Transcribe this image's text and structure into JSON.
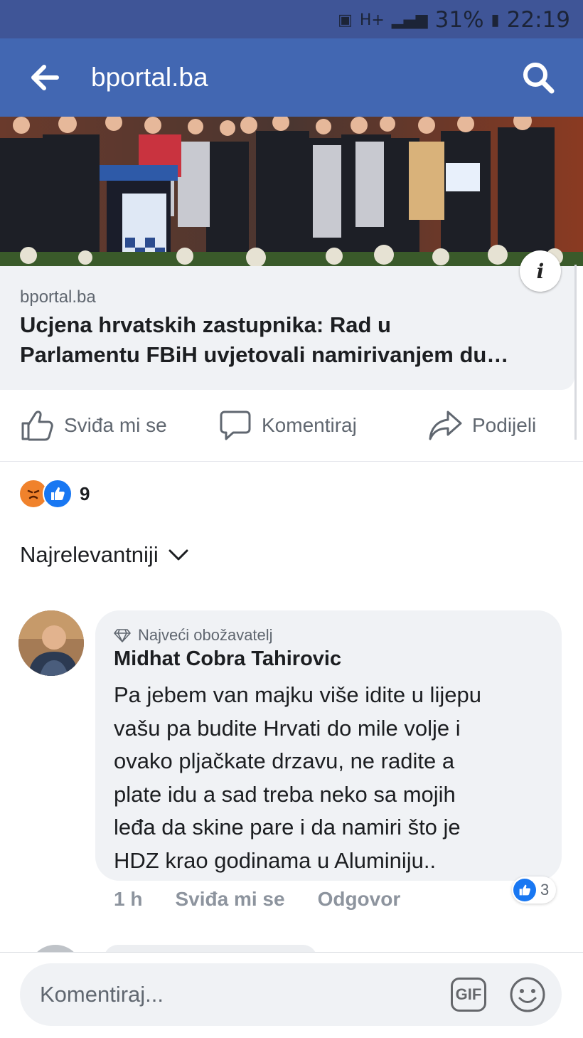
{
  "status_bar": {
    "network": "H+",
    "battery": "31%",
    "time": "22:19"
  },
  "app_bar": {
    "title": "bportal.ba"
  },
  "link_preview": {
    "domain": "bportal.ba",
    "title_line1": "Ucjena hrvatskih zastupnika: Rad u",
    "title_line2": "Parlamentu FBiH uvjetovali namirivanjem du…",
    "image_alt": "group photo of politicians at a podium"
  },
  "actions": {
    "like": "Sviđa mi se",
    "comment": "Komentiraj",
    "share": "Podijeli"
  },
  "reactions": {
    "count": "9"
  },
  "sort": {
    "label": "Najrelevantniji"
  },
  "comment": {
    "badge": "Najveći obožavatelj",
    "author": "Midhat Cobra Tahirovic",
    "lines": [
      "Pa jebem van majku više idite u lijepu",
      "vašu pa budite Hrvati do mile volje i",
      "ovako pljačkate drzavu, ne radite a",
      "plate idu a sad treba neko sa mojih",
      "leđa da skine pare i da namiri što je",
      "HDZ krao godinama u Aluminiju.."
    ],
    "time": "1 h",
    "like_label": "Sviđa mi se",
    "reply_label": "Odgovor",
    "reaction_count": "3"
  },
  "composer": {
    "placeholder": "Komentiraj...",
    "gif_label": "GIF"
  },
  "colors": {
    "brand": "#4267b2",
    "status_bar": "#3f5597",
    "bubble": "#f0f2f5",
    "like_blue": "#1877f2"
  }
}
